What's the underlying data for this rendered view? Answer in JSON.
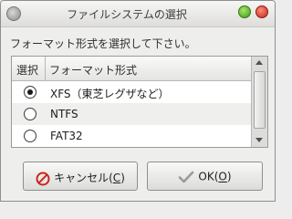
{
  "window": {
    "title": "ファイルシステムの選択"
  },
  "prompt": "フォーマット形式を選択して下さい。",
  "table": {
    "headers": {
      "select": "選択",
      "format": "フォーマット形式"
    },
    "rows": [
      {
        "label": "XFS（東芝レグザなど）",
        "selected": true
      },
      {
        "label": "NTFS",
        "selected": false
      },
      {
        "label": "FAT32",
        "selected": false
      }
    ]
  },
  "buttons": {
    "cancel": {
      "label": "キャンセル(",
      "mnemonic": "C",
      "suffix": ")",
      "icon": "cancel-icon"
    },
    "ok": {
      "label": "OK(",
      "mnemonic": "O",
      "suffix": ")",
      "icon": "checkmark-icon"
    }
  },
  "colors": {
    "cancel_icon": "#c9281c",
    "checkmark_icon": "#9a9a9a"
  }
}
